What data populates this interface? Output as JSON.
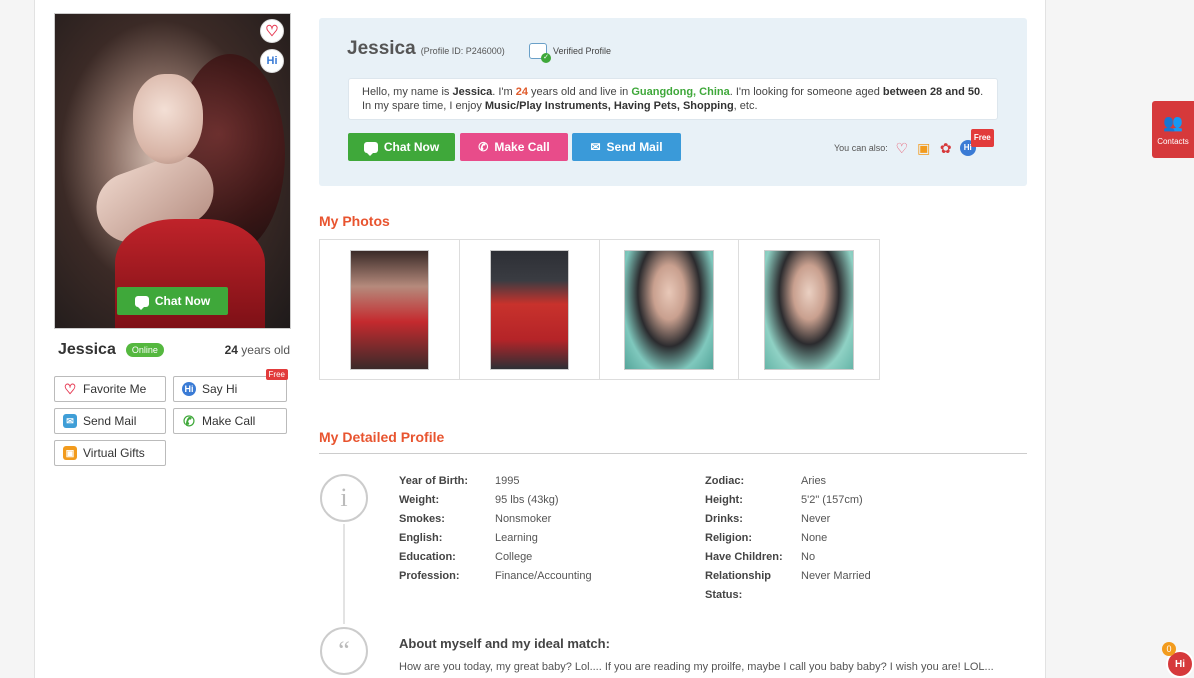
{
  "profile": {
    "name": "Jessica",
    "profile_id": "(Profile ID: P246000)",
    "verified": "Verified Profile",
    "status": "Online",
    "age_num": "24",
    "age_suffix": " years old",
    "chat_overlay": "Chat Now"
  },
  "left_buttons": {
    "favorite": "Favorite Me",
    "say_hi": "Say Hi",
    "free": "Free",
    "send_mail": "Send Mail",
    "make_call": "Make Call",
    "virtual_gifts": "Virtual Gifts"
  },
  "intro": {
    "p1": "Hello, my name is ",
    "name": "Jessica",
    "p2": ". I'm ",
    "age": "24",
    "p3": " years old and live in ",
    "location": "Guangdong, China",
    "p4": ". I'm looking for someone aged ",
    "range": "between 28 and 50",
    "p5": ". In my spare time, I enjoy ",
    "hobbies": "Music/Play Instruments, Having Pets, Shopping",
    "p6": ", etc."
  },
  "actions": {
    "chat": "Chat Now",
    "call": "Make Call",
    "mail": "Send Mail",
    "you_can_also": "You can also:",
    "free": "Free"
  },
  "sections": {
    "photos": "My Photos",
    "detailed": "My Detailed Profile"
  },
  "details_left": [
    {
      "k": "Year of Birth:",
      "v": "1995"
    },
    {
      "k": "Weight:",
      "v": "95 lbs (43kg)"
    },
    {
      "k": "Smokes:",
      "v": "Nonsmoker"
    },
    {
      "k": "English:",
      "v": "Learning"
    },
    {
      "k": "Education:",
      "v": "College"
    },
    {
      "k": "Profession:",
      "v": "Finance/Accounting"
    }
  ],
  "details_right": [
    {
      "k": "Zodiac:",
      "v": "Aries"
    },
    {
      "k": "Height:",
      "v": "5'2\" (157cm)"
    },
    {
      "k": "Drinks:",
      "v": "Never"
    },
    {
      "k": "Religion:",
      "v": "None"
    },
    {
      "k": "Have Children:",
      "v": "No"
    },
    {
      "k": "Relationship",
      "v": "Never Married"
    },
    {
      "k": "Status:",
      "v": ""
    }
  ],
  "about": {
    "title": "About myself and my ideal match:",
    "text": "How are you today, my great baby? Lol.... If you are reading my proilfe, maybe I call you baby baby? I wish you are! LOL..."
  },
  "widgets": {
    "contacts": "Contacts",
    "hi_count": "0",
    "hi": "Hi"
  }
}
